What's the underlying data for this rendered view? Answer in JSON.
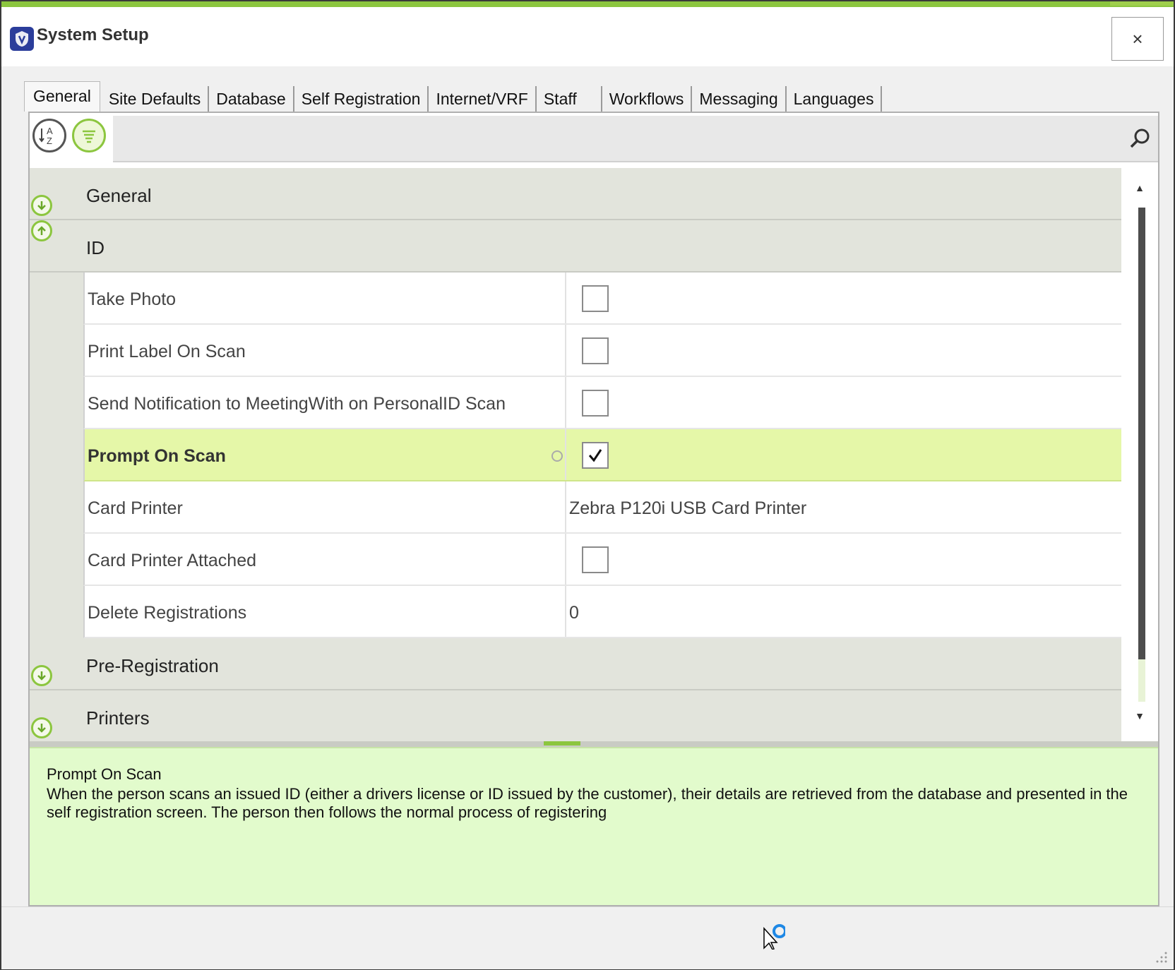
{
  "window": {
    "title": "System Setup",
    "close_label": "×"
  },
  "tabs": [
    {
      "label": "General"
    },
    {
      "label": "Site Defaults"
    },
    {
      "label": "Database"
    },
    {
      "label": "Self Registration"
    },
    {
      "label": "Internet/VRF"
    },
    {
      "label": "Staff"
    },
    {
      "label": "Workflows"
    },
    {
      "label": "Messaging"
    },
    {
      "label": "Languages"
    }
  ],
  "active_tab": "General",
  "toolbar": {
    "sort_alphabetical_icon": "sort-az-icon",
    "categorized_icon": "categorized-icon",
    "search_value": "",
    "search_icon": "search-icon"
  },
  "grid": {
    "categories": [
      {
        "label": "General",
        "expanded": false
      },
      {
        "label": "ID",
        "expanded": true
      },
      {
        "label": "Pre-Registration",
        "expanded": false
      },
      {
        "label": "Printers",
        "expanded": false
      }
    ],
    "id_properties": [
      {
        "name": "Take Photo",
        "type": "checkbox",
        "checked": false
      },
      {
        "name": "Print Label On Scan",
        "type": "checkbox",
        "checked": false
      },
      {
        "name": "Send Notification to MeetingWith on PersonalID Scan",
        "type": "checkbox",
        "checked": false
      },
      {
        "name": "Prompt On Scan",
        "type": "checkbox",
        "checked": true,
        "selected": true
      },
      {
        "name": "Card Printer",
        "type": "text",
        "value": "Zebra P120i USB Card Printer"
      },
      {
        "name": "Card Printer Attached",
        "type": "checkbox",
        "checked": false
      },
      {
        "name": "Delete Registrations",
        "type": "text",
        "value": "0"
      }
    ]
  },
  "description": {
    "title": "Prompt On Scan",
    "text": "When the person scans an issued ID (either a drivers license or ID issued by the customer), their details are retrieved from the database and presented in the self registration screen. The person then follows the normal process of registering"
  },
  "colors": {
    "accent": "#8cc63f",
    "selected_row": "#e5f7a8",
    "description_bg": "#e2fbcc",
    "category_bg": "#e2e4dc"
  }
}
